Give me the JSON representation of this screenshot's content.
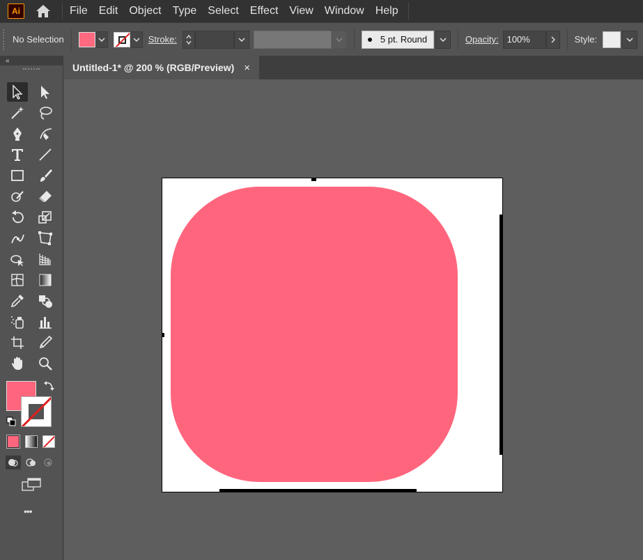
{
  "app": {
    "logo_text": "Ai"
  },
  "menu": [
    "File",
    "Edit",
    "Object",
    "Type",
    "Select",
    "Effect",
    "View",
    "Window",
    "Help"
  ],
  "control_bar": {
    "selection": "No Selection",
    "stroke_label": "Stroke:",
    "brush": "5 pt. Round",
    "opacity_label": "Opacity:",
    "opacity_value": "100%",
    "style_label": "Style:",
    "fill_color": "#ff6a80"
  },
  "document": {
    "tab_title": "Untitled-1* @ 200 % (RGB/Preview)",
    "close": "×"
  },
  "toolbar": {
    "collapse": "«",
    "more": "•••",
    "fill_color": "#ff667d"
  },
  "artwork": {
    "shape_color": "#ff667d"
  }
}
